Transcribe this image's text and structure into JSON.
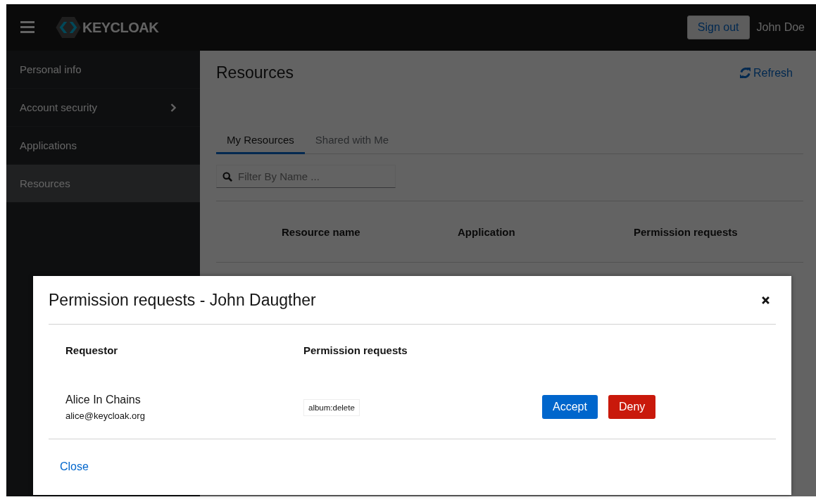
{
  "header": {
    "logo_text": "KEYCLOAK",
    "sign_out": "Sign out",
    "user": "John Doe"
  },
  "sidebar": {
    "items": [
      {
        "label": "Personal info",
        "selected": false,
        "kind": "link"
      },
      {
        "label": "Account security",
        "selected": false,
        "kind": "group"
      },
      {
        "label": "Applications",
        "selected": false,
        "kind": "link"
      },
      {
        "label": "Resources",
        "selected": true,
        "kind": "link"
      }
    ]
  },
  "main": {
    "title": "Resources",
    "refresh": "Refresh",
    "tabs": [
      {
        "label": "My Resources",
        "selected": true
      },
      {
        "label": "Shared with Me",
        "selected": false
      }
    ],
    "filter": {
      "placeholder": "Filter By Name ..."
    },
    "table": {
      "columns": [
        "Resource name",
        "Application",
        "Permission requests"
      ]
    }
  },
  "modal": {
    "title": "Permission requests - John Daugther",
    "columns": [
      "Requestor",
      "Permission requests"
    ],
    "rows": [
      {
        "name": "Alice In Chains",
        "email": "alice@keycloak.org",
        "scope": "album:delete",
        "accept": "Accept",
        "deny": "Deny"
      }
    ],
    "close": "Close"
  }
}
